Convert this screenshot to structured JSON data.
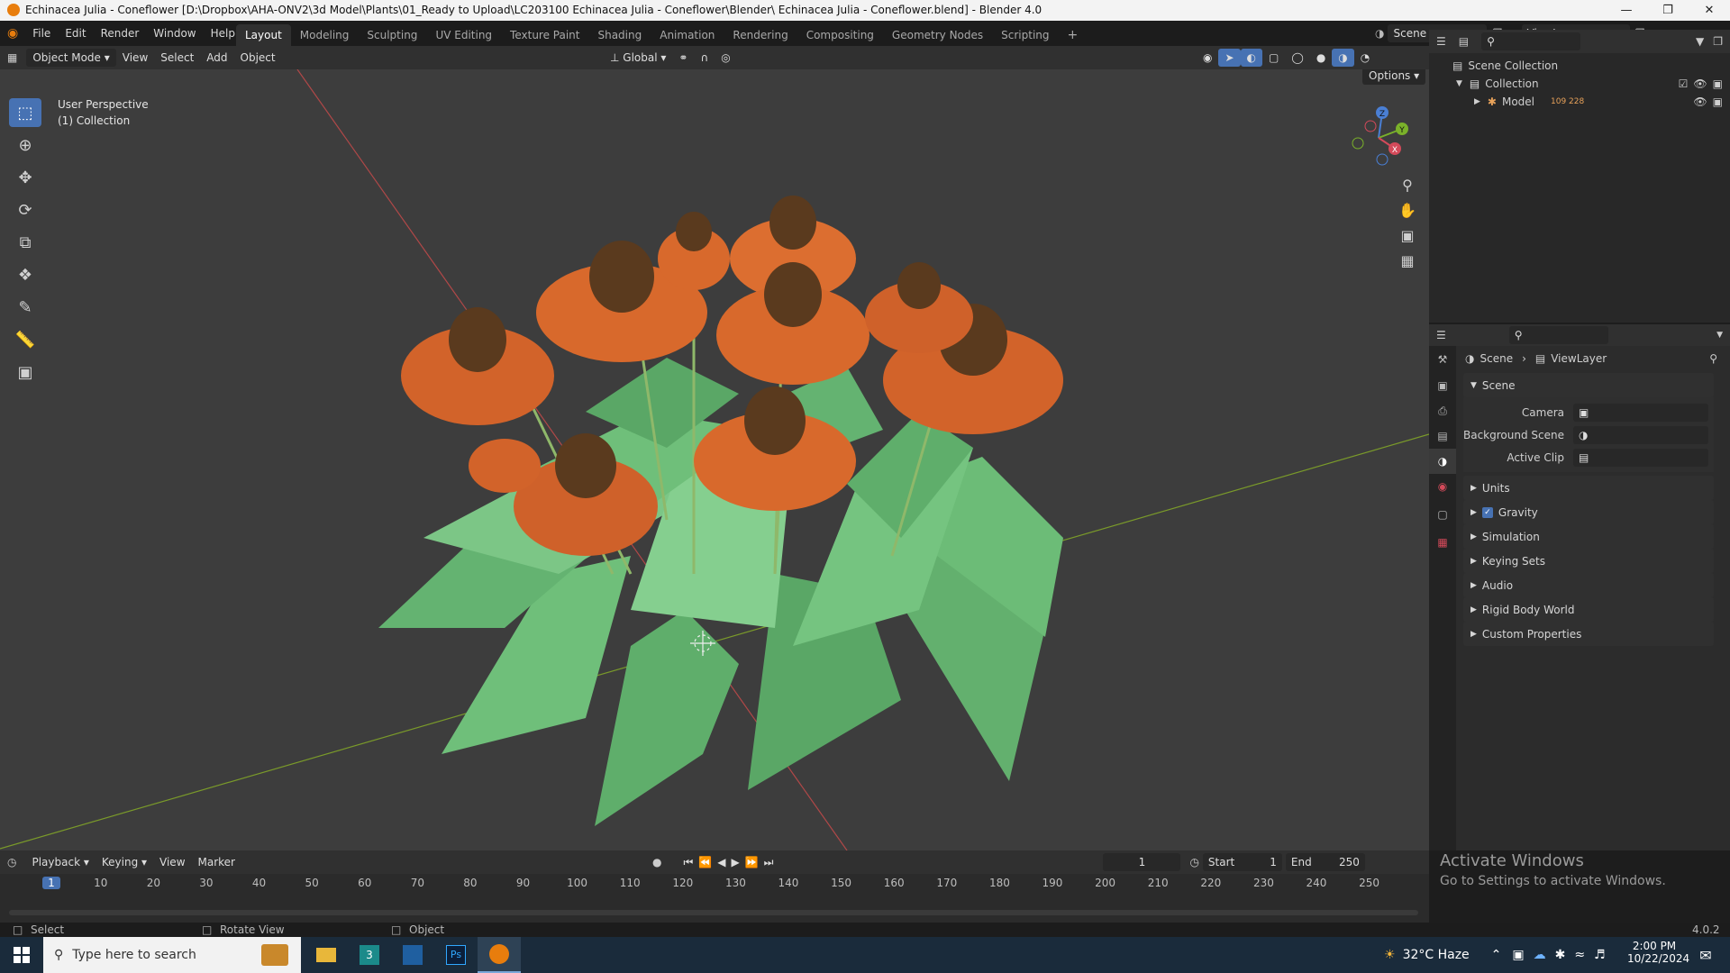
{
  "title_bar": {
    "text": "Echinacea Julia - Coneflower [D:\\Dropbox\\AHA-ONV2\\3d Model\\Plants\\01_Ready to Upload\\LC203100 Echinacea Julia - Coneflower\\Blender\\ Echinacea Julia - Coneflower.blend] - Blender 4.0"
  },
  "menu": {
    "file": "File",
    "edit": "Edit",
    "render": "Render",
    "window": "Window",
    "help": "Help"
  },
  "workspaces": [
    "Layout",
    "Modeling",
    "Sculpting",
    "UV Editing",
    "Texture Paint",
    "Shading",
    "Animation",
    "Rendering",
    "Compositing",
    "Geometry Nodes",
    "Scripting"
  ],
  "scene_selector": {
    "scene": "Scene",
    "view_layer": "ViewLayer"
  },
  "viewport_header": {
    "mode": "Object Mode",
    "view": "View",
    "select": "Select",
    "add": "Add",
    "object": "Object",
    "orientation": "Global",
    "options": "Options"
  },
  "viewport": {
    "perspective": "User Perspective",
    "collection": "(1) Collection"
  },
  "gizmo": {
    "x": "X",
    "y": "Y",
    "z": "Z"
  },
  "outliner": {
    "scene_collection": "Scene Collection",
    "collection": "Collection",
    "model": "Model",
    "model_badge": "109 228"
  },
  "properties": {
    "breadcrumb_scene": "Scene",
    "breadcrumb_viewlayer": "ViewLayer",
    "scene_panel": "Scene",
    "camera": "Camera",
    "background_scene": "Background Scene",
    "active_clip": "Active Clip",
    "panels": [
      "Units",
      "Gravity",
      "Simulation",
      "Keying Sets",
      "Audio",
      "Rigid Body World",
      "Custom Properties"
    ]
  },
  "timeline": {
    "playback": "Playback",
    "keying": "Keying",
    "view": "View",
    "marker": "Marker",
    "current_frame": "1",
    "start_label": "Start",
    "start": "1",
    "end_label": "End",
    "end": "250",
    "ticks": [
      "1",
      "10",
      "20",
      "30",
      "40",
      "50",
      "60",
      "70",
      "80",
      "90",
      "100",
      "110",
      "120",
      "130",
      "140",
      "150",
      "160",
      "170",
      "180",
      "190",
      "200",
      "210",
      "220",
      "230",
      "240",
      "250"
    ]
  },
  "activate_windows": {
    "title": "Activate Windows",
    "subtitle": "Go to Settings to activate Windows."
  },
  "status_bar": {
    "select": "Select",
    "rotate": "Rotate View",
    "object": "Object",
    "version": "4.0.2"
  },
  "taskbar": {
    "search_placeholder": "Type here to search",
    "weather": "32°C  Haze",
    "time": "2:00 PM",
    "date": "10/22/2024"
  },
  "colors": {
    "accent": "#4772b3",
    "viewport_bg": "#3d3d3d",
    "petal": "#d8692c",
    "leaf": "#6fbf7a"
  }
}
